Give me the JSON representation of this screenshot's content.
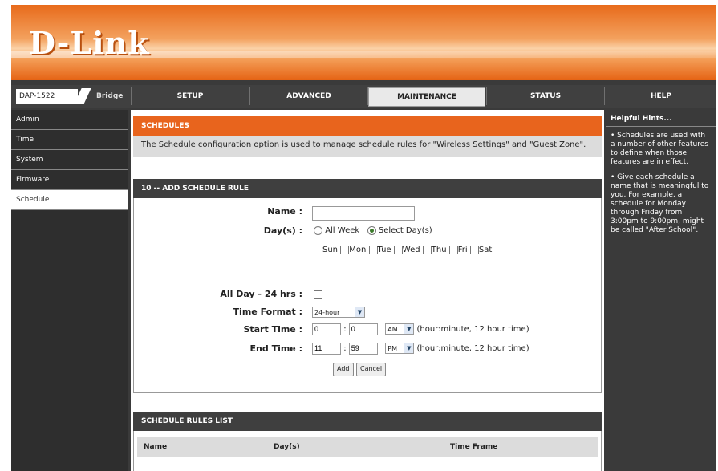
{
  "brand": {
    "logo": "D-Link"
  },
  "topnav": {
    "model": "DAP-1522",
    "mode": "Bridge",
    "tabs": [
      {
        "label": "SETUP"
      },
      {
        "label": "ADVANCED"
      },
      {
        "label": "MAINTENANCE"
      },
      {
        "label": "STATUS"
      },
      {
        "label": "HELP"
      }
    ]
  },
  "sidebar": {
    "items": [
      {
        "label": "Admin"
      },
      {
        "label": "Time"
      },
      {
        "label": "System"
      },
      {
        "label": "Firmware"
      },
      {
        "label": "Schedule"
      }
    ]
  },
  "schedules": {
    "title": "SCHEDULES",
    "description": "The Schedule configuration option is used to manage schedule rules for \"Wireless Settings\" and \"Guest Zone\"."
  },
  "add_rule": {
    "title": "10 -- ADD SCHEDULE RULE",
    "name_label": "Name :",
    "name_value": "",
    "days_label": "Day(s) :",
    "all_week_label": "All Week",
    "select_days_label": "Select Day(s)",
    "days": [
      "Sun",
      "Mon",
      "Tue",
      "Wed",
      "Thu",
      "Fri",
      "Sat"
    ],
    "all_day_label": "All Day - 24 hrs :",
    "time_format_label": "Time Format :",
    "time_format_value": "24-hour",
    "start_time_label": "Start Time :",
    "start_hour": "0",
    "start_minute": "0",
    "start_ampm": "AM",
    "end_time_label": "End Time :",
    "end_hour": "11",
    "end_minute": "59",
    "end_ampm": "PM",
    "time_hint": "(hour:minute, 12 hour time)",
    "add_button": "Add",
    "cancel_button": "Cancel"
  },
  "rules_list": {
    "title": "SCHEDULE RULES LIST",
    "columns": [
      "Name",
      "Day(s)",
      "Time Frame"
    ]
  },
  "hints": {
    "title": "Helpful Hints...",
    "items": [
      "• Schedules are used with a number of other features to define when those features are in effect.",
      "• Give each schedule a name that is meaningful to you. For example, a schedule for Monday through Friday from 3:00pm to 9:00pm, might be called \"After School\"."
    ]
  },
  "colors": {
    "accent": "#e8641d",
    "dark": "#3a3a3a"
  }
}
